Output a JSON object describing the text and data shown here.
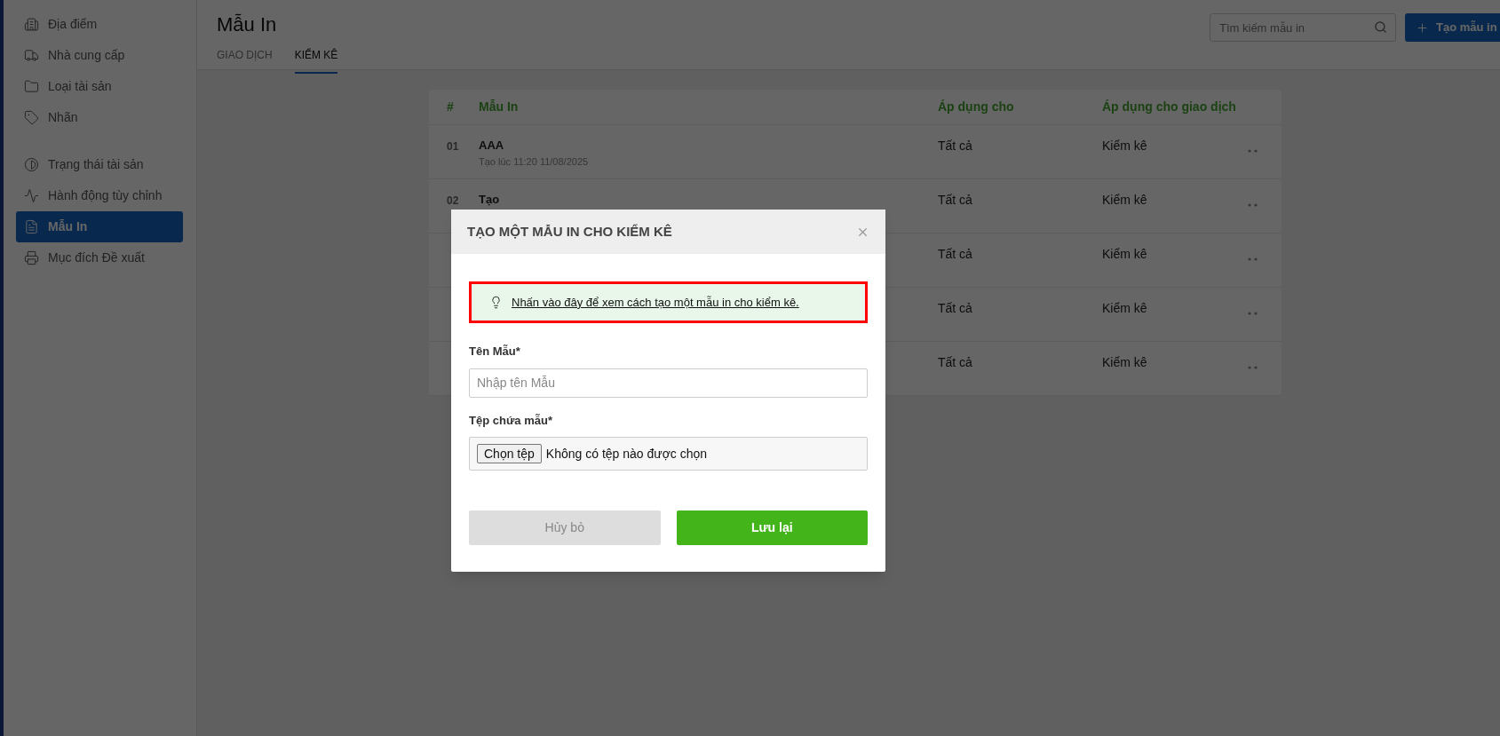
{
  "sidebar": {
    "groups": [
      {
        "items": [
          {
            "label": "Địa điểm",
            "selected": false
          },
          {
            "label": "Nhà cung cấp",
            "selected": false
          },
          {
            "label": "Loại tài sản",
            "selected": false
          },
          {
            "label": "Nhãn",
            "selected": false
          }
        ]
      },
      {
        "items": [
          {
            "label": "Trạng thái tài sản",
            "selected": false
          },
          {
            "label": "Hành động tùy chỉnh",
            "selected": false
          },
          {
            "label": "Mẫu In",
            "selected": true
          },
          {
            "label": "Mục đích Đề xuất",
            "selected": false
          }
        ]
      }
    ]
  },
  "header": {
    "title": "Mẫu In",
    "tabs": [
      {
        "label": "GIAO DỊCH",
        "selected": false
      },
      {
        "label": "KIỂM KÊ",
        "selected": true
      }
    ],
    "search": {
      "placeholder": "Tìm kiếm mẫu in"
    },
    "create_button": "Tạo mẫu in"
  },
  "table": {
    "columns": [
      "#",
      "Mẫu In",
      "Áp dụng cho",
      "Áp dụng cho giao dịch"
    ],
    "rows": [
      {
        "number": "01",
        "name": "AAA",
        "created": "Tạo lúc 11:20 11/08/2025",
        "apply_to": "Tất cả",
        "transaction": "Kiểm kê"
      },
      {
        "number": "02",
        "name": "Tạo",
        "apply_to": "Tất cả",
        "transaction": "Kiểm kê"
      },
      {
        "apply_to": "Tất cả",
        "transaction": "Kiểm kê"
      },
      {
        "apply_to": "Tất cả",
        "transaction": "Kiểm kê"
      },
      {
        "apply_to": "Tất cả",
        "transaction": "Kiểm kê"
      }
    ]
  },
  "modal": {
    "title": "TẠO MỘT MẪU IN CHO KIỂM KÊ",
    "hint": "Nhấn vào đây để xem cách tạo một mẫu in cho kiểm kê.",
    "fields": [
      {
        "kind": "text",
        "label": "Tên Mẫu*",
        "placeholder": "Nhập tên Mẫu"
      },
      {
        "kind": "file",
        "label": "Tệp chứa mẫu*",
        "button": "Chọn tệp",
        "status": "Không có tệp nào được chọn"
      }
    ],
    "buttons": [
      {
        "kind": "cancel",
        "label": "Hủy bỏ"
      },
      {
        "kind": "save",
        "label": "Lưu lại"
      }
    ]
  }
}
